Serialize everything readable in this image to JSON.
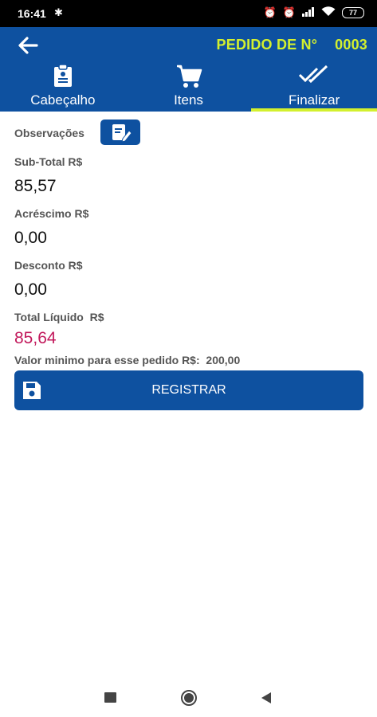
{
  "status": {
    "time": "16:41",
    "battery": "77"
  },
  "header": {
    "order_label": "PEDIDO DE N°",
    "order_number": "0003"
  },
  "tabs": [
    {
      "label": "Cabeçalho",
      "icon": "clipboard-icon"
    },
    {
      "label": "Itens",
      "icon": "cart-icon"
    },
    {
      "label": "Finalizar",
      "icon": "double-check-icon"
    }
  ],
  "form": {
    "observacoes_label": "Observações",
    "subtotal_label": "Sub-Total R$",
    "subtotal_value": "85,57",
    "acrescimo_label": "Acréscimo R$",
    "acrescimo_value": "0,00",
    "desconto_label": "Desconto R$",
    "desconto_value": "0,00",
    "total_label": "Total Líquido  R$",
    "total_value": "85,64",
    "min_note": "Valor minimo para esse pedido R$:  200,00"
  },
  "actions": {
    "register_label": "REGISTRAR"
  },
  "colors": {
    "primary": "#0e51a0",
    "accent": "#d3f02e",
    "total": "#c2185b"
  }
}
